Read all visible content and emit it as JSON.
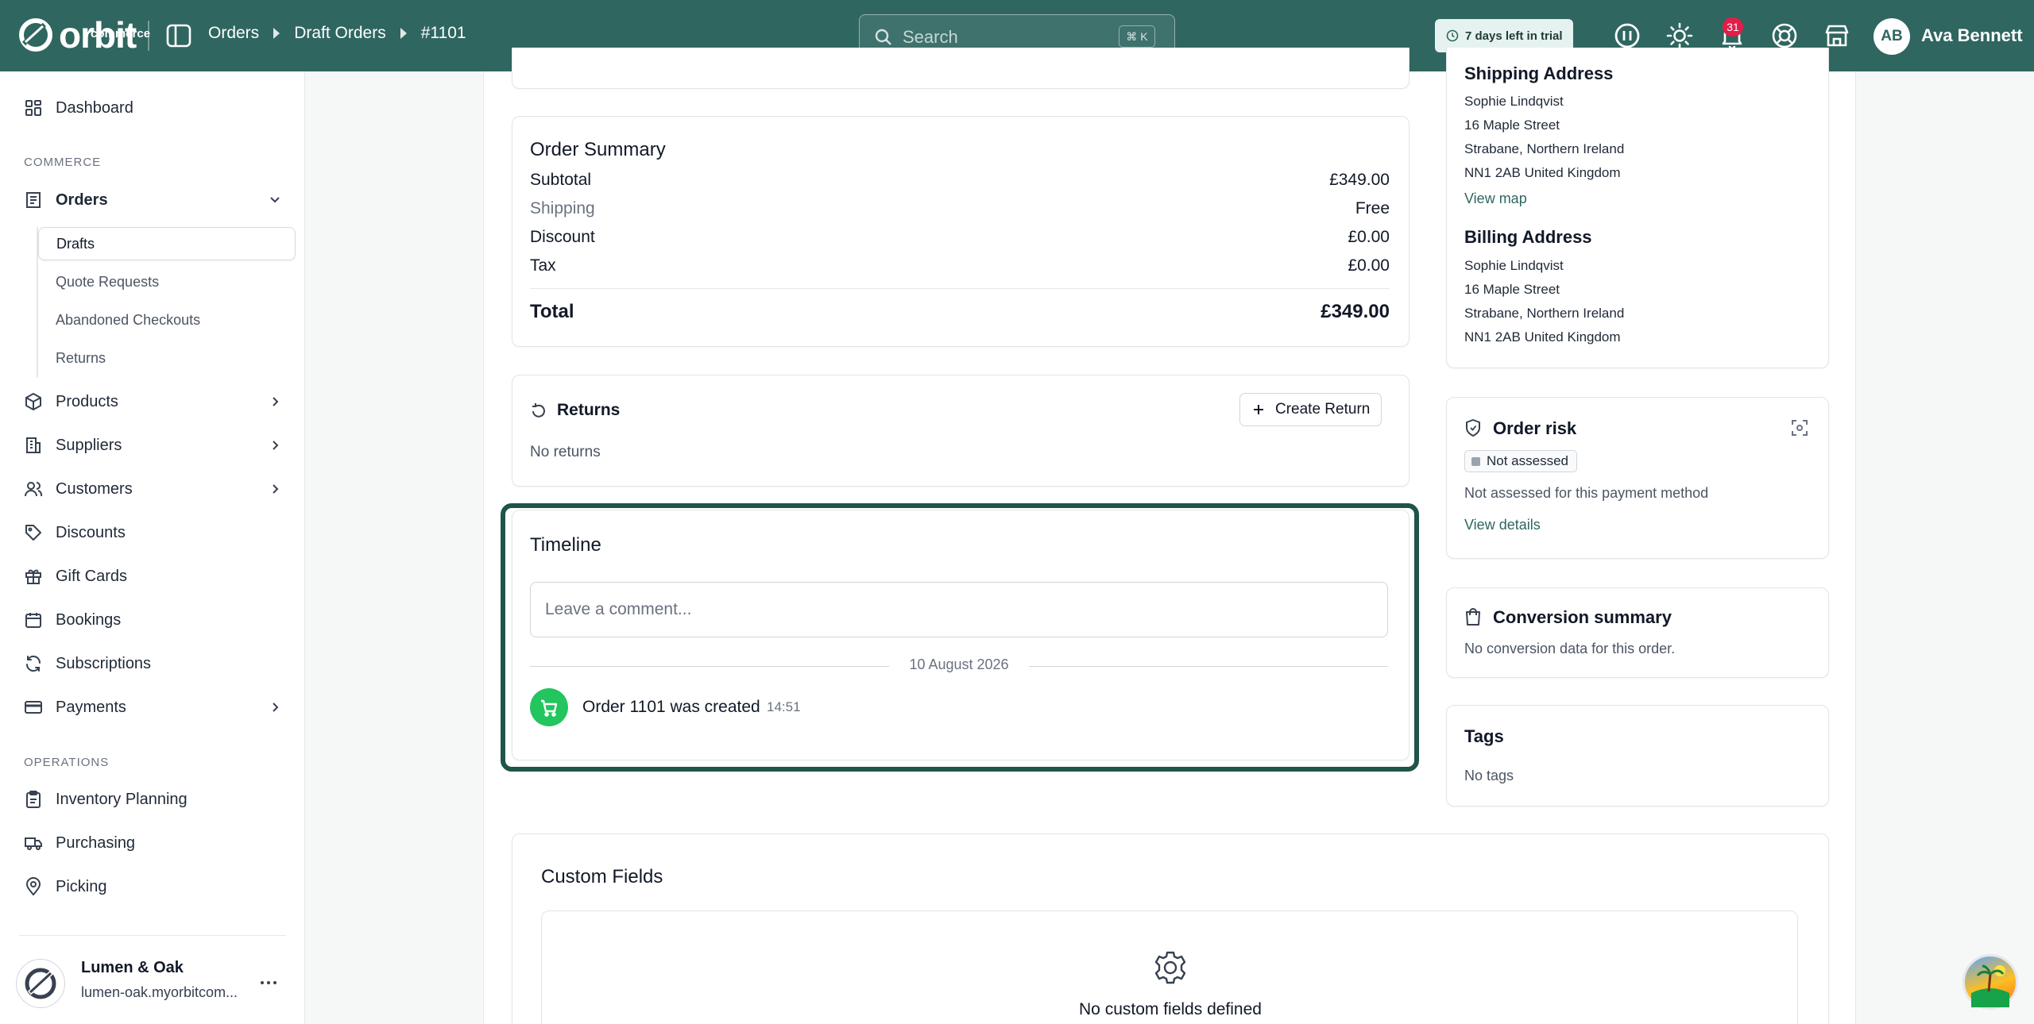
{
  "header": {
    "logo_text": "orbit",
    "logo_sub": "commerce",
    "breadcrumbs": [
      "Orders",
      "Draft Orders",
      "#1101"
    ],
    "search_placeholder": "Search",
    "search_shortcut": "⌘ K",
    "trial_label": "7 days left in trial",
    "notification_count": "31",
    "user_initials": "AB",
    "user_name": "Ava Bennett"
  },
  "sidebar": {
    "dashboard": "Dashboard",
    "section_commerce": "COMMERCE",
    "orders": "Orders",
    "orders_sub": [
      "Drafts",
      "Quote Requests",
      "Abandoned Checkouts",
      "Returns"
    ],
    "products": "Products",
    "suppliers": "Suppliers",
    "customers": "Customers",
    "discounts": "Discounts",
    "gift_cards": "Gift Cards",
    "bookings": "Bookings",
    "subscriptions": "Subscriptions",
    "payments": "Payments",
    "section_operations": "OPERATIONS",
    "inventory_planning": "Inventory Planning",
    "purchasing": "Purchasing",
    "picking": "Picking",
    "store_name": "Lumen & Oak",
    "store_url": "lumen-oak.myorbitcom..."
  },
  "order_summary": {
    "title": "Order Summary",
    "rows": [
      {
        "label": "Subtotal",
        "value": "£349.00"
      },
      {
        "label": "Shipping",
        "value": "Free"
      },
      {
        "label": "Discount",
        "value": "£0.00"
      },
      {
        "label": "Tax",
        "value": "£0.00"
      }
    ],
    "total_label": "Total",
    "total_value": "£349.00"
  },
  "returns": {
    "title": "Returns",
    "create_button": "Create Return",
    "empty": "No returns"
  },
  "timeline": {
    "title": "Timeline",
    "comment_placeholder": "Leave a comment...",
    "date": "10 August 2026",
    "event_text": "Order 1101 was created",
    "event_time": "14:51"
  },
  "shipping_address": {
    "title": "Shipping Address",
    "lines": [
      "Sophie Lindqvist",
      "16 Maple Street",
      "Strabane, Northern Ireland",
      "NN1 2AB United Kingdom"
    ],
    "view_map": "View map"
  },
  "billing_address": {
    "title": "Billing Address",
    "lines": [
      "Sophie Lindqvist",
      "16 Maple Street",
      "Strabane, Northern Ireland",
      "NN1 2AB United Kingdom"
    ]
  },
  "order_risk": {
    "title": "Order risk",
    "status": "Not assessed",
    "description": "Not assessed for this payment method",
    "link": "View details"
  },
  "conversion": {
    "title": "Conversion summary",
    "description": "No conversion data for this order."
  },
  "tags": {
    "title": "Tags",
    "empty": "No tags"
  },
  "custom_fields": {
    "title": "Custom Fields",
    "empty": "No custom fields defined"
  },
  "colors": {
    "brand": "#2f6660",
    "highlight": "#1f5449",
    "success": "#22c55e",
    "badge": "#e11d48"
  }
}
